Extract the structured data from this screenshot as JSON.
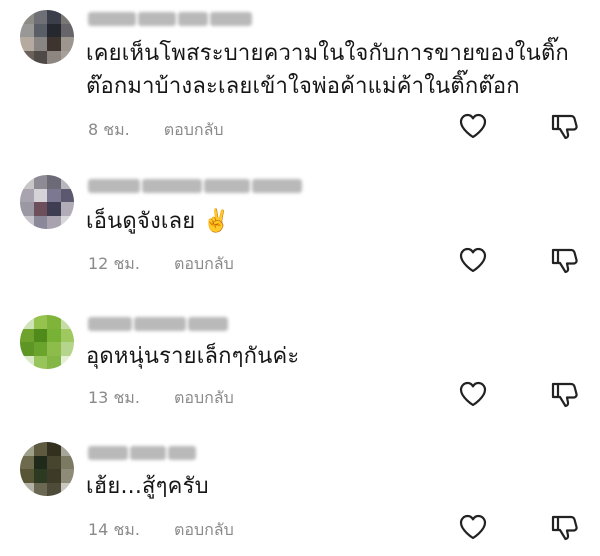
{
  "comments": [
    {
      "name": "",
      "text_lines": [
        "เคยเห็นโพสระบายความในใจกับการขายของในติ๊ก",
        "ต๊อกมาบ้างละเลยเข้าใจพ่อค้าแม่ค้าในติ๊กต๊อก"
      ],
      "time": "8 ชม.",
      "reply_label": "ตอบกลับ",
      "avatar_colors": [
        "#8e8a86",
        "#6f6f76",
        "#3a3f4a",
        "#7a7674",
        "#9a9896",
        "#5a5e66",
        "#25282f",
        "#67646a",
        "#b5aaa0",
        "#8a8585",
        "#3d3430",
        "#9c968f",
        "#6b615b",
        "#4f4a48",
        "#8d8680",
        "#a7a09a"
      ]
    },
    {
      "name": "",
      "text_lines": [
        "เอ็นดูจังเลย ✌️"
      ],
      "time": "12 ชม.",
      "reply_label": "ตอบกลับ",
      "avatar_colors": [
        "#c9c6c8",
        "#8e8b95",
        "#6d6a78",
        "#b9b6bb",
        "#a9a3b0",
        "#d6d3d8",
        "#7c7891",
        "#5c5870",
        "#9b98a4",
        "#6c4f5a",
        "#3f3d52",
        "#b1acb8",
        "#c8c4cc",
        "#8b889a",
        "#a8a3ae",
        "#d9d7dc"
      ]
    },
    {
      "name": "",
      "text_lines": [
        "อุดหนุ่นรายเล็กๆกันค่ะ"
      ],
      "time": "13 ชม.",
      "reply_label": "ตอบกลับ",
      "avatar_colors": [
        "#cfe3b8",
        "#96c24e",
        "#7fb33a",
        "#c5dca5",
        "#6fa22c",
        "#4f8a1a",
        "#78b235",
        "#9fc860",
        "#5d9624",
        "#6aa42d",
        "#8dbc4a",
        "#b6d58c",
        "#dbe9c8",
        "#97c45b",
        "#84b646",
        "#e4efd6"
      ]
    },
    {
      "name": "",
      "text_lines": [
        "เฮ้ย...สู้ๆครับ"
      ],
      "time": "14 ชม.",
      "reply_label": "ตอบกลับ",
      "avatar_colors": [
        "#9fa08a",
        "#5d5a40",
        "#33301f",
        "#a8a69a",
        "#6e6a4e",
        "#1f2a1a",
        "#48452f",
        "#7d7a63",
        "#575536",
        "#2c3a22",
        "#3d3a28",
        "#8e8b78",
        "#b4b2a6",
        "#6a6752",
        "#4e4c38",
        "#cac8bf"
      ]
    }
  ],
  "icons": {
    "like": "heart-outline-icon",
    "dislike": "thumbs-down-outline-icon"
  },
  "colors": {
    "text": "#161616",
    "meta": "#8a8a8a",
    "icon": "#222222"
  }
}
